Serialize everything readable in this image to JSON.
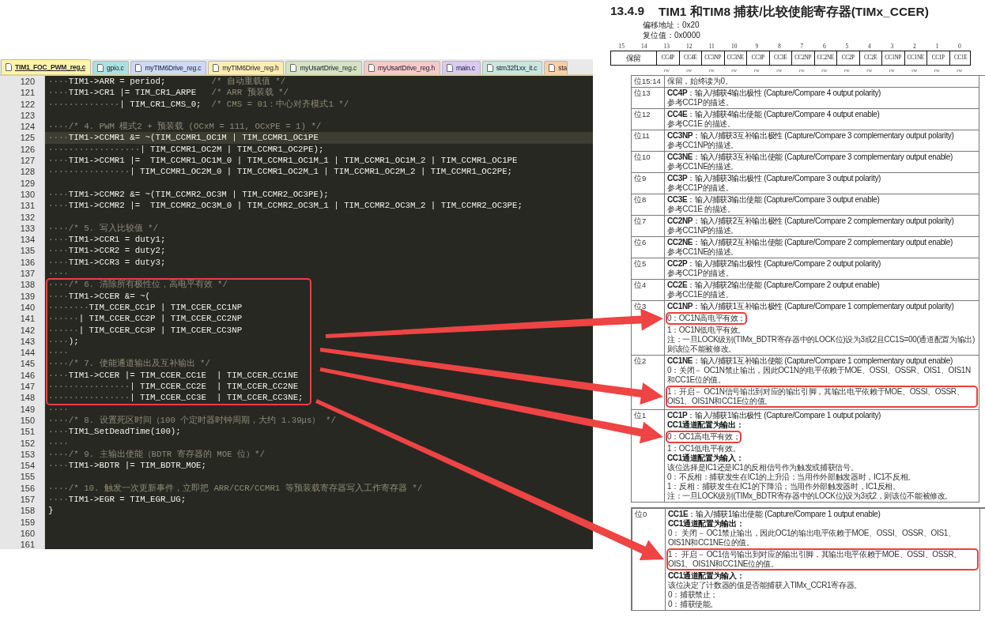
{
  "editor": {
    "tabs": [
      {
        "label": "TIM1_FOC_PWM_reg.c",
        "color": "#fff4a8",
        "selected": true
      },
      {
        "label": "gpio.c",
        "color": "#a9e2e0",
        "selected": false
      },
      {
        "label": "myTIM6Drive_reg.c",
        "color": "#cdd9f7",
        "selected": false
      },
      {
        "label": "myTIM6Drive_reg.h",
        "color": "#fdeeb0",
        "selected": false
      },
      {
        "label": "myUsartDrive_reg.c",
        "color": "#d3e3c4",
        "selected": false
      },
      {
        "label": "myUsartDrive_reg.h",
        "color": "#f7c9c9",
        "selected": false
      },
      {
        "label": "main.c",
        "color": "#d9c9f3",
        "selected": false
      },
      {
        "label": "stm32f1xx_it.c",
        "color": "#c9e6de",
        "selected": false
      },
      {
        "label": "sta",
        "color": "#f9cfa5",
        "selected": false
      }
    ],
    "lines": [
      {
        "n": "120",
        "indent": "····",
        "code": "TIM1->ARR = period;         ",
        "comment": "/* 自动重载值 */",
        "current": false,
        "boxed": false
      },
      {
        "n": "121",
        "indent": "····",
        "code": "TIM1->CR1 |= TIM_CR1_ARPE   ",
        "comment": "/* ARR 预装载 */",
        "current": false,
        "boxed": false
      },
      {
        "n": "122",
        "indent": "··············",
        "code": "| TIM_CR1_CMS_0;  ",
        "comment": "/* CMS = 01：中心对齐模式1 */",
        "current": false,
        "boxed": false
      },
      {
        "n": "123",
        "current": false,
        "boxed": false
      },
      {
        "n": "124",
        "indent": "····",
        "comment": "/* 4. PWM 模式2 + 预装载 (OCxM = 111, OCxPE = 1) */",
        "current": false,
        "boxed": false
      },
      {
        "n": "125",
        "indent": "····",
        "code": "TIM1->CCMR1 &= ~(TIM_CCMR1_OC1M | TIM_CCMR1_OC1PE",
        "current": true,
        "boxed": false
      },
      {
        "n": "126",
        "indent": "··················",
        "code": "| TIM_CCMR1_OC2M | TIM_CCMR1_OC2PE);",
        "current": false,
        "boxed": false
      },
      {
        "n": "127",
        "indent": "····",
        "code": "TIM1->CCMR1 |=  TIM_CCMR1_OC1M_0 | TIM_CCMR1_OC1M_1 | TIM_CCMR1_OC1M_2 | TIM_CCMR1_OC1PE",
        "current": false,
        "boxed": false
      },
      {
        "n": "128",
        "indent": "················",
        "code": "| TIM_CCMR1_OC2M_0 | TIM_CCMR1_OC2M_1 | TIM_CCMR1_OC2M_2 | TIM_CCMR1_OC2PE;",
        "current": false,
        "boxed": false
      },
      {
        "n": "129",
        "current": false,
        "boxed": false
      },
      {
        "n": "130",
        "indent": "····",
        "code": "TIM1->CCMR2 &= ~(TIM_CCMR2_OC3M | TIM_CCMR2_OC3PE);",
        "current": false,
        "boxed": false
      },
      {
        "n": "131",
        "indent": "····",
        "code": "TIM1->CCMR2 |=  TIM_CCMR2_OC3M_0 | TIM_CCMR2_OC3M_1 | TIM_CCMR2_OC3M_2 | TIM_CCMR2_OC3PE;",
        "current": false,
        "boxed": false
      },
      {
        "n": "132",
        "current": false,
        "boxed": false
      },
      {
        "n": "133",
        "indent": "····",
        "comment": "/* 5. 写入比较值 */",
        "current": false,
        "boxed": false
      },
      {
        "n": "134",
        "indent": "····",
        "code": "TIM1->CCR1 = duty1;",
        "current": false,
        "boxed": false
      },
      {
        "n": "135",
        "indent": "····",
        "code": "TIM1->CCR2 = duty2;",
        "current": false,
        "boxed": false
      },
      {
        "n": "136",
        "indent": "····",
        "code": "TIM1->CCR3 = duty3;",
        "current": false,
        "boxed": false
      },
      {
        "n": "137",
        "indent": "····",
        "current": false,
        "boxed": false
      },
      {
        "n": "138",
        "indent": "····",
        "comment": "/* 6. 清除所有极性位，高电平有效 */",
        "current": false,
        "boxed": true
      },
      {
        "n": "139",
        "indent": "····",
        "code": "TIM1->CCER &= ~(",
        "current": false,
        "boxed": true
      },
      {
        "n": "140",
        "indent": "········",
        "code": "TIM_CCER_CC1P | TIM_CCER_CC1NP",
        "current": false,
        "boxed": true
      },
      {
        "n": "141",
        "indent": "······",
        "code": "| TIM_CCER_CC2P | TIM_CCER_CC2NP",
        "current": false,
        "boxed": true
      },
      {
        "n": "142",
        "indent": "······",
        "code": "| TIM_CCER_CC3P | TIM_CCER_CC3NP",
        "current": false,
        "boxed": true
      },
      {
        "n": "143",
        "indent": "····",
        "code": ");",
        "current": false,
        "boxed": true
      },
      {
        "n": "144",
        "indent": "····",
        "current": false,
        "boxed": true
      },
      {
        "n": "145",
        "indent": "····",
        "comment": "/* 7. 使能通道输出及互补输出 */",
        "current": false,
        "boxed": true
      },
      {
        "n": "146",
        "indent": "····",
        "code": "TIM1->CCER |= TIM_CCER_CC1E  | TIM_CCER_CC1NE",
        "current": false,
        "boxed": true
      },
      {
        "n": "147",
        "indent": "················",
        "code": "| TIM_CCER_CC2E  | TIM_CCER_CC2NE",
        "current": false,
        "boxed": true
      },
      {
        "n": "148",
        "indent": "················",
        "code": "| TIM_CCER_CC3E  | TIM_CCER_CC3NE;",
        "current": false,
        "boxed": true
      },
      {
        "n": "149",
        "indent": "····",
        "current": false,
        "boxed": false
      },
      {
        "n": "150",
        "indent": "····",
        "comment": "/* 8. 设置死区时间（100 个定时器时钟周期，大约 1.39μs） */",
        "current": false,
        "boxed": false
      },
      {
        "n": "151",
        "indent": "····",
        "code": "TIM1_SetDeadTime(100);",
        "current": false,
        "boxed": false
      },
      {
        "n": "152",
        "indent": "····",
        "current": false,
        "boxed": false
      },
      {
        "n": "153",
        "indent": "····",
        "comment": "/* 9. 主输出使能（BDTR 寄存器的 MOE 位）*/",
        "current": false,
        "boxed": false
      },
      {
        "n": "154",
        "indent": "····",
        "code": "TIM1->BDTR |= TIM_BDTR_MOE;",
        "current": false,
        "boxed": false
      },
      {
        "n": "155",
        "current": false,
        "boxed": false
      },
      {
        "n": "156",
        "indent": "····",
        "comment": "/* 10. 触发一次更新事件，立即把 ARR/CCR/CCMR1 等预装载寄存器写入工作寄存器 */",
        "current": false,
        "boxed": false
      },
      {
        "n": "157",
        "indent": "····",
        "code": "TIM1->EGR = TIM_EGR_UG;",
        "current": false,
        "boxed": false
      },
      {
        "n": "158",
        "code": "}",
        "current": false,
        "boxed": false
      },
      {
        "n": "159",
        "current": false,
        "boxed": false
      },
      {
        "n": "160",
        "current": false,
        "boxed": false
      },
      {
        "n": "161",
        "current": false,
        "boxed": false
      }
    ]
  },
  "doc": {
    "section_number": "13.4.9",
    "title": "TIM1 和TIM8 捕获/比较使能寄存器(TIMx_CCER)",
    "offset": "偏移地址：0x20",
    "reset_value": "复位值：0x0000",
    "bit_numbers": [
      "15",
      "14",
      "13",
      "12",
      "11",
      "10",
      "9",
      "8",
      "7",
      "6",
      "5",
      "4",
      "3",
      "2",
      "1",
      "0"
    ],
    "register_fields": [
      {
        "label": "保留",
        "kind": "reserved"
      },
      {
        "label": "CC4P",
        "kind": "bit"
      },
      {
        "label": "CC4E",
        "kind": "bit"
      },
      {
        "label": "CC3NP",
        "kind": "bit"
      },
      {
        "label": "CC3NE",
        "kind": "bit"
      },
      {
        "label": "CC3P",
        "kind": "bit"
      },
      {
        "label": "CC3E",
        "kind": "bit"
      },
      {
        "label": "CC2NP",
        "kind": "bit"
      },
      {
        "label": "CC2NE",
        "kind": "bit"
      },
      {
        "label": "CC2P",
        "kind": "bit"
      },
      {
        "label": "CC2E",
        "kind": "bit"
      },
      {
        "label": "CC1NP",
        "kind": "bit"
      },
      {
        "label": "CC1NE",
        "kind": "bit"
      },
      {
        "label": "CC1P",
        "kind": "bit"
      },
      {
        "label": "CC1E",
        "kind": "bit"
      }
    ],
    "access": [
      "rw",
      "rw",
      "rw",
      "rw",
      "rw",
      "rw",
      "rw",
      "rw",
      "rw",
      "rw",
      "rw",
      "rw",
      "rw",
      "rw"
    ],
    "bit_tables": [
      {
        "rows": [
          {
            "bit": "位15:14",
            "lines": [
              {
                "text": "保留，始终读为0。",
                "kind": "plain",
                "boxed": false
              }
            ]
          },
          {
            "bit": "位13",
            "lines": [
              {
                "text": "**CC4P**：输入/捕获4输出极性 (Capture/Compare 4 output polarity)",
                "kind": "title",
                "boxed": false
              },
              {
                "text": "参考CC1P的描述。",
                "kind": "plain",
                "boxed": false
              }
            ]
          },
          {
            "bit": "位12",
            "lines": [
              {
                "text": "**CC4E**：输入/捕获4输出使能 (Capture/Compare 4 output enable)",
                "kind": "title",
                "boxed": false
              },
              {
                "text": "参考CC1E 的描述。",
                "kind": "plain",
                "boxed": false
              }
            ]
          },
          {
            "bit": "位11",
            "lines": [
              {
                "text": "**CC3NP**：输入/捕获3互补输出极性 (Capture/Compare 3 complementary output polarity)",
                "kind": "title",
                "boxed": false
              },
              {
                "text": "参考CC1NP的描述。",
                "kind": "plain",
                "boxed": false
              }
            ]
          },
          {
            "bit": "位10",
            "lines": [
              {
                "text": "**CC3NE**：输入/捕获3互补输出使能 (Capture/Compare 3 complementary output enable)",
                "kind": "title",
                "boxed": false
              },
              {
                "text": "参考CC1NE的描述。",
                "kind": "plain",
                "boxed": false
              }
            ]
          },
          {
            "bit": "位9",
            "lines": [
              {
                "text": "**CC3P**：输入/捕获3输出极性 (Capture/Compare 3 output polarity)",
                "kind": "title",
                "boxed": false
              },
              {
                "text": "参考CC1P的描述。",
                "kind": "plain",
                "boxed": false
              }
            ]
          },
          {
            "bit": "位8",
            "lines": [
              {
                "text": "**CC3E**：输入/捕获3输出使能 (Capture/Compare 3 output enable)",
                "kind": "title",
                "boxed": false
              },
              {
                "text": "参考CC1E 的描述。",
                "kind": "plain",
                "boxed": false
              }
            ]
          },
          {
            "bit": "位7",
            "lines": [
              {
                "text": "**CC2NP**：输入/捕获2互补输出极性 (Capture/Compare 2 complementary output polarity)",
                "kind": "title",
                "boxed": false
              },
              {
                "text": "参考CC1NP的描述。",
                "kind": "plain",
                "boxed": false
              }
            ]
          },
          {
            "bit": "位6",
            "lines": [
              {
                "text": "**CC2NE**：输入/捕获2互补输出使能 (Capture/Compare 2 complementary output enable)",
                "kind": "title",
                "boxed": false
              },
              {
                "text": "参考CC1NE的描述。",
                "kind": "plain",
                "boxed": false
              }
            ]
          },
          {
            "bit": "位5",
            "lines": [
              {
                "text": "**CC2P**：输入/捕获2输出极性 (Capture/Compare 2 output polarity)",
                "kind": "title",
                "boxed": false
              },
              {
                "text": "参考CC1P的描述。",
                "kind": "plain",
                "boxed": false
              }
            ]
          },
          {
            "bit": "位4",
            "lines": [
              {
                "text": "**CC2E**：输入/捕获2输出使能 (Capture/Compare 2 output enable)",
                "kind": "title",
                "boxed": false
              },
              {
                "text": "参考CC1E的描述。",
                "kind": "plain",
                "boxed": false
              }
            ]
          },
          {
            "bit": "位3",
            "lines": [
              {
                "text": "**CC1NP**：输入/捕获1互补输出极性 (Capture/Compare 1 complementary output polarity)",
                "kind": "title",
                "boxed": false
              },
              {
                "text": "0：OC1N高电平有效；",
                "kind": "plain",
                "boxed": true
              },
              {
                "text": "1：OC1N低电平有效。",
                "kind": "plain",
                "boxed": false
              },
              {
                "text": "注：一旦LOCK级别(TIMx_BDTR寄存器中的LOCK位)设为3或2且CC1S=00(通道配置为输出)则该位不能被修改。",
                "kind": "plain",
                "boxed": false
              }
            ]
          },
          {
            "bit": "位2",
            "lines": [
              {
                "text": "**CC1NE**：输入/捕获1互补输出使能 (Capture/Compare 1 complementary output enable)",
                "kind": "title",
                "boxed": false
              },
              {
                "text": "0：关闭－ OC1N禁止输出，因此OC1N的电平依赖于MOE、OSSI、OSSR、OIS1、OIS1N和CC1E位的值。",
                "kind": "plain",
                "boxed": false
              },
              {
                "text": "1：开启－ OC1N信号输出到对应的输出引脚，其输出电平依赖于MOE、OSSI、OSSR、OIS1、OIS1N和CC1E位的值。",
                "kind": "plain",
                "boxed": true
              }
            ]
          },
          {
            "bit": "位1",
            "lines": [
              {
                "text": "**CC1P**：输入/捕获1输出极性 (Capture/Compare 1 output polarity)",
                "kind": "title",
                "boxed": false
              },
              {
                "text": "CC1通道配置为输出：",
                "kind": "bold",
                "boxed": false
              },
              {
                "text": "0：OC1高电平有效；",
                "kind": "plain",
                "boxed": true
              },
              {
                "text": "1：OC1低电平有效。",
                "kind": "plain",
                "boxed": false
              },
              {
                "text": "CC1通道配置为输入：",
                "kind": "bold",
                "boxed": false
              },
              {
                "text": "该位选择是IC1还是IC1的反相信号作为触发或捕获信号。",
                "kind": "plain",
                "boxed": false
              },
              {
                "text": "0：不反相：捕获发生在IC1的上升沿；当用作外部触发器时，IC1不反相。",
                "kind": "plain",
                "boxed": false
              },
              {
                "text": "1：反相：捕获发生在IC1的下降沿；当用作外部触发器时，IC1反相。",
                "kind": "plain",
                "boxed": false
              },
              {
                "text": "注：一旦LOCK级别(TIMx_BDTR寄存器中的LOCK位)设为3或2，则该位不能被修改。",
                "kind": "plain",
                "boxed": false
              }
            ]
          }
        ]
      },
      {
        "rows": [
          {
            "bit": "位0",
            "lines": [
              {
                "text": "**CC1E**：输入/捕获1输出使能 (Capture/Compare 1 output enable)",
                "kind": "title",
                "boxed": false
              },
              {
                "text": "CC1通道配置为输出：",
                "kind": "bold",
                "boxed": false
              },
              {
                "text": "0： 关闭－ OC1禁止输出，因此OC1的输出电平依赖于MOE、OSSI、OSSR、OIS1、OIS1N和CC1NE位的值。",
                "kind": "plain",
                "boxed": false
              },
              {
                "text": "1： 开启－ OC1信号输出到对应的输出引脚，其输出电平依赖于MOE、OSSI、OSSR、OIS1、OIS1N和CC1NE位的值。",
                "kind": "plain",
                "boxed": true
              },
              {
                "text": "CC1通道配置为输入：",
                "kind": "bold",
                "boxed": false
              },
              {
                "text": "该位决定了计数器的值是否能捕获入TIMx_CCR1寄存器。",
                "kind": "plain",
                "boxed": false
              },
              {
                "text": "0：捕获禁止；",
                "kind": "plain",
                "boxed": false
              },
              {
                "text": "0：捕获使能。",
                "kind": "plain",
                "boxed": false
              }
            ]
          }
        ]
      }
    ]
  }
}
